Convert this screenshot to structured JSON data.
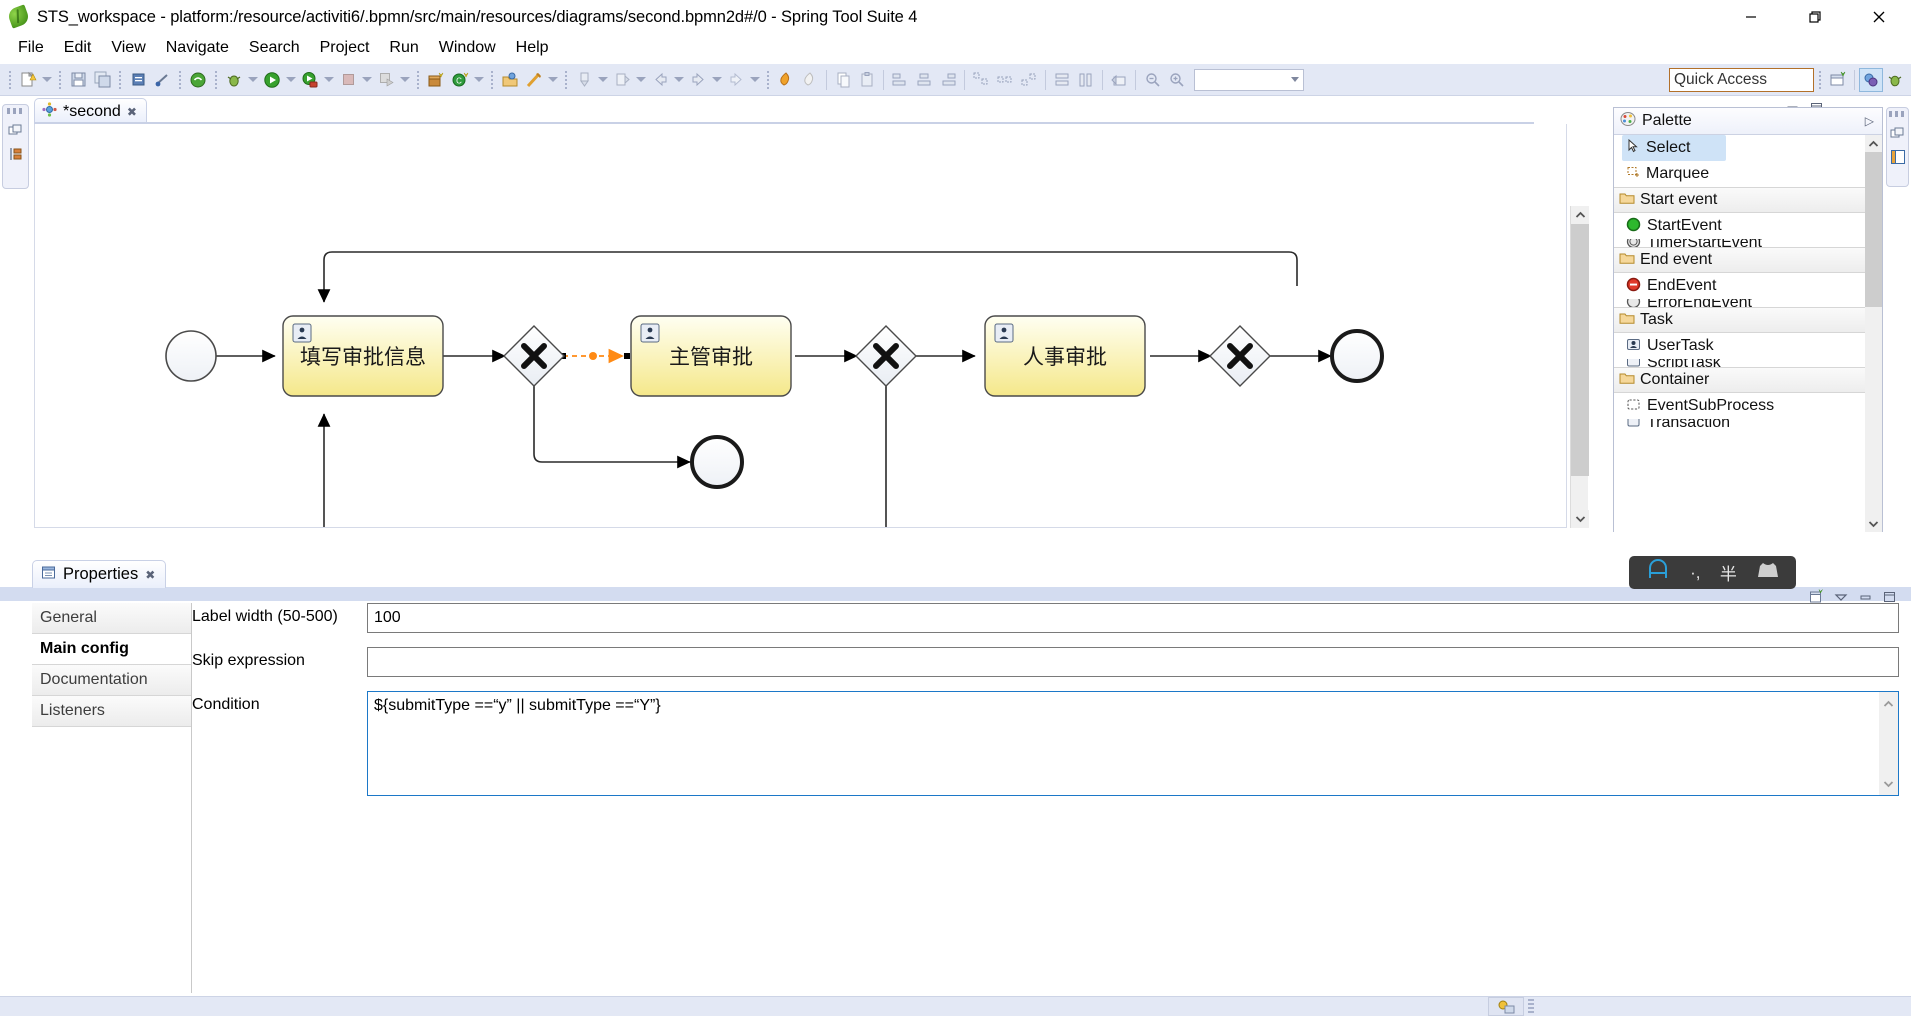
{
  "window": {
    "title": "STS_workspace - platform:/resource/activiti6/.bpmn/src/main/resources/diagrams/second.bpmn2d#/0 - Spring Tool Suite 4",
    "app_icon": "spring-leaf-icon",
    "minimize": "minimize-icon",
    "restore": "restore-icon",
    "close": "close-icon"
  },
  "menubar": {
    "items": [
      "File",
      "Edit",
      "View",
      "Navigate",
      "Search",
      "Project",
      "Run",
      "Window",
      "Help"
    ]
  },
  "toolbar": {
    "quick_access": "Quick Access",
    "combo_value": "",
    "groups": [
      {
        "name": "new-group",
        "icons": [
          "new-file-icon",
          "caret-down-icon"
        ]
      },
      {
        "name": "save-group",
        "icons": [
          "save-icon",
          "save-all-icon"
        ]
      },
      {
        "name": "print-group",
        "icons": [
          "print-icon",
          "link-icon"
        ]
      },
      {
        "name": "boot-group",
        "icons": [
          "boot-dashboard-icon",
          "debug-icon",
          "caret-down-icon",
          "run-icon",
          "caret-down-icon",
          "run-config-icon",
          "caret-down-icon",
          "stop-icon",
          "caret-down-icon",
          "terminate-icon",
          "caret-down-icon"
        ]
      },
      {
        "name": "new-wizard-group",
        "icons": [
          "new-package-icon",
          "new-class-icon",
          "caret-down-icon"
        ]
      },
      {
        "name": "open-group",
        "icons": [
          "open-type-icon",
          "search-pen-icon",
          "caret-down-icon"
        ]
      },
      {
        "name": "nav-group",
        "icons": [
          "previous-annotation-icon",
          "caret-down-icon",
          "next-edit-icon",
          "caret-down-icon",
          "back-icon",
          "forward-icon",
          "caret-down-icon",
          "forward2-icon",
          "caret-down-icon"
        ]
      },
      {
        "name": "bpmn-group",
        "icons": [
          "bpmn-fire-icon",
          "bpmn-undo-icon"
        ]
      },
      {
        "name": "clipboard-group",
        "icons": [
          "copy-icon",
          "paste-icon"
        ]
      },
      {
        "name": "align-group",
        "icons": [
          "align-left-icon",
          "align-center-icon",
          "align-right-icon"
        ]
      },
      {
        "name": "distribute-group",
        "icons": [
          "distribute-top-icon",
          "distribute-middle-icon",
          "distribute-bottom-icon"
        ]
      },
      {
        "name": "size-group",
        "icons": [
          "match-width-icon",
          "match-height-icon"
        ]
      },
      {
        "name": "export-group",
        "icons": [
          "export-image-icon"
        ]
      },
      {
        "name": "zoom-group",
        "icons": [
          "zoom-out-icon",
          "zoom-in-icon"
        ]
      }
    ],
    "perspective_icons": [
      "open-perspective-icon",
      "java-ee-perspective-icon",
      "debug-perspective-icon"
    ]
  },
  "editor": {
    "left_rail_icons": [
      "restore-view-icon",
      "outline-view-icon"
    ],
    "tab": {
      "label": "*second",
      "icon": "bpmn-diagram-icon",
      "close": "close-icon"
    },
    "minimize": "minimize-icon",
    "maximize": "maximize-icon",
    "scrollbar": {
      "up": "chevron-up-icon",
      "down": "chevron-down-icon"
    }
  },
  "diagram": {
    "nodes": [
      {
        "id": "start",
        "type": "start-event",
        "label": ""
      },
      {
        "id": "task1",
        "type": "user-task",
        "label": "填写审批信息"
      },
      {
        "id": "gw1",
        "type": "exclusive-gateway",
        "label": ""
      },
      {
        "id": "task2",
        "type": "user-task",
        "label": "主管审批"
      },
      {
        "id": "gw2",
        "type": "exclusive-gateway",
        "label": ""
      },
      {
        "id": "task3",
        "type": "user-task",
        "label": "人事审批"
      },
      {
        "id": "gw3",
        "type": "exclusive-gateway",
        "label": ""
      },
      {
        "id": "end1",
        "type": "end-event",
        "label": ""
      },
      {
        "id": "end2",
        "type": "end-event",
        "label": ""
      }
    ],
    "selected_flow": "gw1-to-task2"
  },
  "palette": {
    "title": "Palette",
    "icon": "palette-icon",
    "expand": "expand-icon",
    "tools": [
      {
        "label": "Select",
        "icon": "cursor-icon",
        "selected": true
      },
      {
        "label": "Marquee",
        "icon": "marquee-icon",
        "selected": false
      }
    ],
    "drawers": [
      {
        "label": "Start event",
        "icon": "folder-icon",
        "pin": "pin-icon",
        "entries": [
          {
            "label": "StartEvent",
            "icon": "start-event-icon"
          },
          {
            "label": "TimerStartEvent",
            "icon": "timer-start-event-icon"
          }
        ]
      },
      {
        "label": "End event",
        "icon": "folder-icon",
        "pin": "pin-icon",
        "entries": [
          {
            "label": "EndEvent",
            "icon": "end-event-icon"
          },
          {
            "label": "ErrorEndEvent",
            "icon": "error-end-event-icon"
          }
        ]
      },
      {
        "label": "Task",
        "icon": "folder-icon",
        "pin": "pin-icon",
        "entries": [
          {
            "label": "UserTask",
            "icon": "user-task-icon"
          },
          {
            "label": "ScriptTask",
            "icon": "script-task-icon"
          }
        ]
      },
      {
        "label": "Container",
        "icon": "folder-icon",
        "pin": "pin-icon",
        "entries": [
          {
            "label": "EventSubProcess",
            "icon": "event-subprocess-icon"
          },
          {
            "label": "Transaction",
            "icon": "transaction-icon"
          }
        ]
      }
    ],
    "scrollbar": {
      "up": "chevron-up-icon",
      "down": "chevron-down-icon"
    },
    "rail_icons": [
      "restore-view-icon",
      "palette-view-icon"
    ]
  },
  "properties": {
    "tab": {
      "label": "Properties",
      "icon": "properties-icon",
      "close": "close-icon"
    },
    "toolbar_icons": [
      "new-properties-icon",
      "view-menu-icon",
      "minimize-icon",
      "maximize-icon"
    ],
    "side_tabs": [
      {
        "label": "General",
        "active": false
      },
      {
        "label": "Main config",
        "active": true
      },
      {
        "label": "Documentation",
        "active": false
      },
      {
        "label": "Listeners",
        "active": false
      }
    ],
    "fields": [
      {
        "name": "label-width",
        "label": "Label width (50-500)",
        "value": "100",
        "placeholder": "",
        "type": "text"
      },
      {
        "name": "skip-expression",
        "label": "Skip expression",
        "value": "",
        "placeholder": "",
        "type": "text"
      },
      {
        "name": "condition",
        "label": "Condition",
        "value": "${submitType ==“y” || submitType ==“Y”}",
        "placeholder": "",
        "type": "textarea"
      }
    ],
    "textarea_scroll": {
      "up": "chevron-up-icon",
      "down": "chevron-down-icon"
    }
  },
  "ime": {
    "items": [
      "chinese-mode-icon",
      "punctuation-icon",
      "half-width-icon",
      "soft-keyboard-icon"
    ]
  },
  "statusbar": {
    "icon": "smart-insert-icon"
  },
  "colors": {
    "toolbar_bg": "#e3e8f5",
    "task_fill_top": "#ffffe8",
    "task_fill_bottom": "#f6e98d",
    "selection": "#cfe3f7",
    "selected_flow": "#ff8a14",
    "focus_border": "#1c78c8"
  }
}
